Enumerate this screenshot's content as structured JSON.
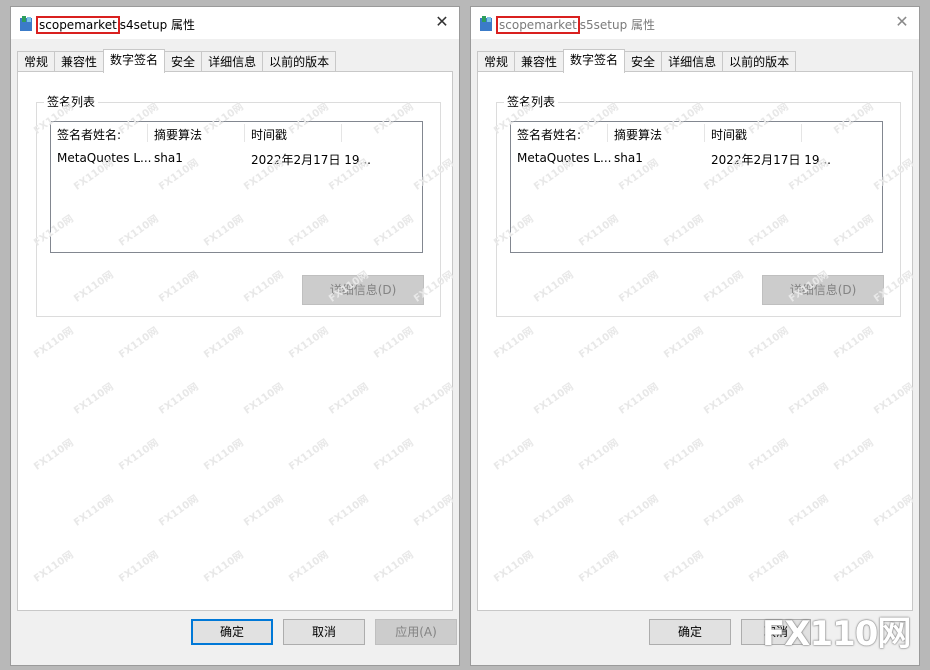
{
  "dialogs": [
    {
      "title_highlight": "scopemarket",
      "title_rest": "s4setup 属性",
      "close_glyph": "✕",
      "tabs": [
        "常规",
        "兼容性",
        "数字签名",
        "安全",
        "详细信息",
        "以前的版本"
      ],
      "active_tab": "数字签名",
      "group_label": "签名列表",
      "columns": [
        "签名者姓名:",
        "摘要算法",
        "时间戳"
      ],
      "rows": [
        [
          "MetaQuotes L...",
          "sha1",
          "2022年2月17日 19..."
        ]
      ],
      "details_button": "详细信息(D)",
      "ok_button": "确定",
      "cancel_button": "取消",
      "apply_button": "应用(A)"
    },
    {
      "title_highlight": "scopemarket",
      "title_rest": "s5setup 属性",
      "close_glyph": "✕",
      "tabs": [
        "常规",
        "兼容性",
        "数字签名",
        "安全",
        "详细信息",
        "以前的版本"
      ],
      "active_tab": "数字签名",
      "group_label": "签名列表",
      "columns": [
        "签名者姓名:",
        "摘要算法",
        "时间戳"
      ],
      "rows": [
        [
          "MetaQuotes L...",
          "sha1",
          "2022年2月17日 19..."
        ]
      ],
      "details_button": "详细信息(D)",
      "ok_button": "确定",
      "cancel_button": "取消"
    }
  ],
  "watermark": "FX110网",
  "brand": "FX110网",
  "colors": {
    "highlight_box": "#d9201f",
    "focus_border": "#0078d7"
  },
  "icons": {
    "app_icon": "installer-icon",
    "close": "close-icon"
  }
}
